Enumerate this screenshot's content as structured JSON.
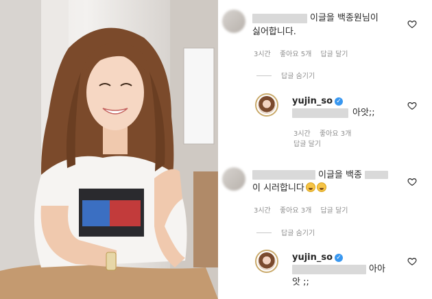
{
  "comments": [
    {
      "text": "이글을 백종원님이",
      "text2": "싫어합니다.",
      "time": "3시간",
      "likes": "좋아요 5개",
      "reply": "답글 달기",
      "hide_replies": "답글 숨기기"
    },
    {
      "username": "yujin_so",
      "text": "아앗;;",
      "time": "3시간",
      "likes": "좋아요 3개",
      "reply": "답글 달기"
    },
    {
      "text": "이글을 백종",
      "text2": "이 시러합니다",
      "time": "3시간",
      "likes": "좋아요 3개",
      "reply": "답글 달기",
      "hide_replies": "답글 숨기기"
    },
    {
      "username": "yujin_so",
      "text": "아아",
      "text2": "앗 ;;"
    }
  ],
  "icons": {
    "verified": "verified-badge-icon",
    "like": "heart-outline-icon",
    "emoji": "rolling-laughing-emoji-icon"
  },
  "colors": {
    "meta": "#8e8e8e",
    "verified": "#3897f0"
  }
}
